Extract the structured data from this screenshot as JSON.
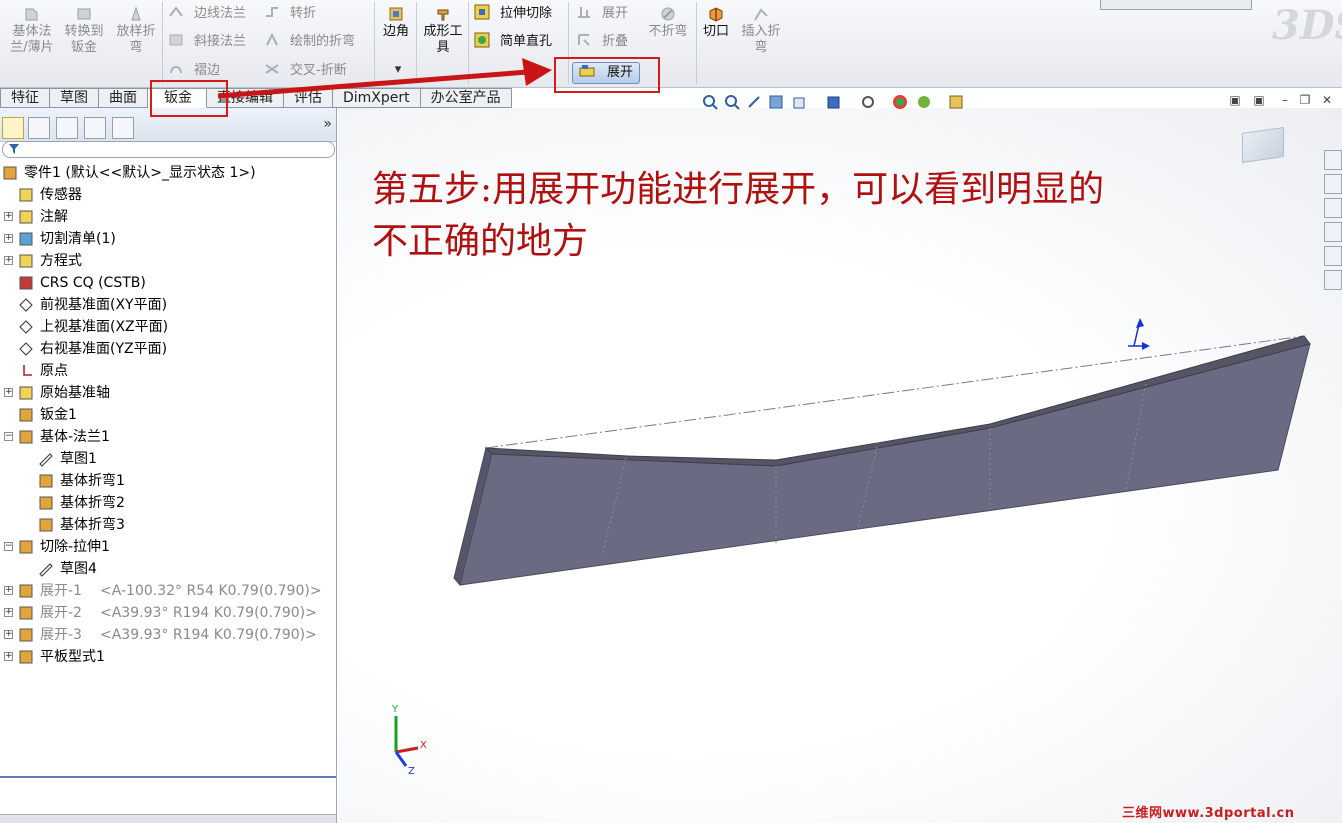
{
  "toolbar": {
    "big_buttons": [
      {
        "label": "基体法兰/薄片",
        "enabled": false
      },
      {
        "label": "转换到钣金",
        "enabled": false
      },
      {
        "label": "放样折弯",
        "enabled": false
      },
      {
        "label": "边角",
        "enabled": true
      },
      {
        "label": "成形工具",
        "enabled": true
      },
      {
        "label": "不折弯",
        "enabled": false
      },
      {
        "label": "切口",
        "enabled": true
      },
      {
        "label": "插入折弯",
        "enabled": false
      }
    ],
    "small_buttons": [
      {
        "label": "边线法兰",
        "enabled": false
      },
      {
        "label": "斜接法兰",
        "enabled": false
      },
      {
        "label": "褶边",
        "enabled": false
      },
      {
        "label": "转折",
        "enabled": false
      },
      {
        "label": "绘制的折弯",
        "enabled": false
      },
      {
        "label": "交叉-折断",
        "enabled": false
      },
      {
        "label": "拉伸切除",
        "enabled": true
      },
      {
        "label": "简单直孔",
        "enabled": true
      },
      {
        "label": "展开",
        "enabled": false
      },
      {
        "label": "折叠",
        "enabled": false
      },
      {
        "label": "展开",
        "enabled": true
      }
    ],
    "logo_text": "3DS"
  },
  "tabs": [
    {
      "label": "特征",
      "active": false
    },
    {
      "label": "草图",
      "active": false
    },
    {
      "label": "曲面",
      "active": false
    },
    {
      "label": "钣金",
      "active": true
    },
    {
      "label": "直接编辑",
      "active": false
    },
    {
      "label": "评估",
      "active": false
    },
    {
      "label": "DimXpert",
      "active": false
    },
    {
      "label": "办公室产品",
      "active": false
    }
  ],
  "panel": {
    "more": "»",
    "tree": [
      {
        "label": "零件1 (默认<<默认>_显示状态 1>)",
        "icon": "part-icon"
      },
      {
        "label": "传感器",
        "icon": "sensor-icon"
      },
      {
        "label": "注解",
        "icon": "annotation-icon"
      },
      {
        "label": "切割清单(1)",
        "icon": "cutlist-icon"
      },
      {
        "label": "方程式",
        "icon": "equation-icon"
      },
      {
        "label": "CRS CQ (CSTB)",
        "icon": "material-icon"
      },
      {
        "label": "前视基准面(XY平面)",
        "icon": "plane-icon"
      },
      {
        "label": "上视基准面(XZ平面)",
        "icon": "plane-icon"
      },
      {
        "label": "右视基准面(YZ平面)",
        "icon": "plane-icon"
      },
      {
        "label": "原点",
        "icon": "origin-icon"
      },
      {
        "label": "原始基准轴",
        "icon": "folder-icon"
      },
      {
        "label": "钣金1",
        "icon": "sheetmetal-icon"
      },
      {
        "label": "基体-法兰1",
        "icon": "flange-icon"
      },
      {
        "label": "草图1",
        "icon": "sketch-icon"
      },
      {
        "label": "基体折弯1",
        "icon": "bend-icon"
      },
      {
        "label": "基体折弯2",
        "icon": "bend-icon"
      },
      {
        "label": "基体折弯3",
        "icon": "bend-icon"
      },
      {
        "label": "切除-拉伸1",
        "icon": "cut-extrude-icon"
      },
      {
        "label": "草图4",
        "icon": "sketch-icon"
      },
      {
        "label": "展开-1",
        "detail": "<A-100.32° R54 K0.79(0.790)>",
        "icon": "unfold-icon"
      },
      {
        "label": "展开-2",
        "detail": "<A39.93° R194 K0.79(0.790)>",
        "icon": "unfold-icon"
      },
      {
        "label": "展开-3",
        "detail": "<A39.93° R194 K0.79(0.790)>",
        "icon": "unfold-icon"
      },
      {
        "label": "平板型式1",
        "icon": "flat-pattern-icon"
      }
    ]
  },
  "viewport": {
    "annotation_line1": "第五步:用展开功能进行展开，可以看到明显的",
    "annotation_line2": "不正确的地方",
    "triad": {
      "x": "X",
      "y": "Y",
      "z": "Z"
    }
  },
  "watermark": "三维网www.3dportal.cn",
  "colors": {
    "highlight": "#d21b1b",
    "annotation": "#b01010",
    "model_face": "#6a6a82",
    "model_edge": "#4a4a5a"
  }
}
